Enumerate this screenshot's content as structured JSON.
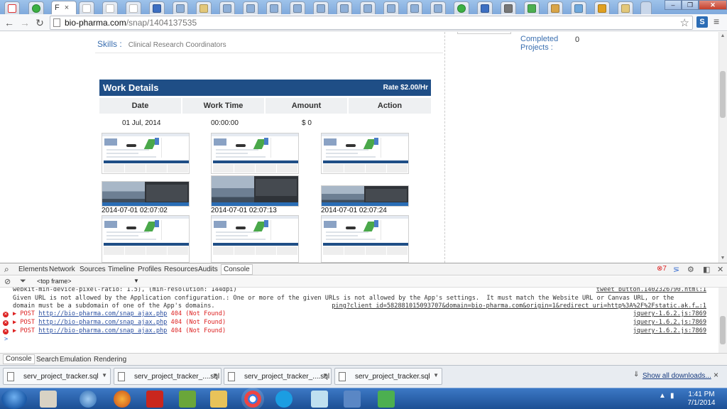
{
  "browser": {
    "active_tab_title": "F",
    "tab_close": "×",
    "url_host": "bio-pharma.com",
    "url_path": "/snap/1404137535",
    "extension_letter": "S"
  },
  "page": {
    "skills_label": "Skills :",
    "skills_value": "Clinical Research Coordinators",
    "completed_label_1": "Completed",
    "completed_label_2": "Projects :",
    "completed_value": "0",
    "work_details_title": "Work Details",
    "rate": "Rate $2.00/Hr",
    "columns": [
      "Date",
      "Work Time",
      "Amount",
      "Action"
    ],
    "row": {
      "date": "01 Jul, 2014",
      "work_time": "00:00:00",
      "amount": "$ 0"
    },
    "timestamps": [
      "2014-07-01 02:07:02",
      "2014-07-01 02:07:13",
      "2014-07-01 02:07:24"
    ]
  },
  "devtools": {
    "tabs": [
      "Elements",
      "Network",
      "Sources",
      "Timeline",
      "Profiles",
      "Resources",
      "Audits",
      "Console"
    ],
    "error_count": "7",
    "frame": "<top frame>",
    "lines": [
      {
        "text": "webkit-min-device-pixel-ratio: 1.5), (min-resolution: 144dpi)",
        "src": "tweet_button.1402326790.html:1"
      },
      {
        "text": "Given URL is not allowed by the Application configuration.: One or more of the given URLs is not allowed by the App's settings.  It must match the Website URL or Canvas URL, or the",
        "src": ""
      },
      {
        "text": "domain must be a subdomain of one of the App's domains.",
        "src": "ping?client_id=582881015093707&domain=bio-pharma.com&origin=1&redirect_uri=http%3A%2F%2Fstatic.ak.f…:1"
      }
    ],
    "errors": [
      {
        "method": "POST",
        "url": "http://bio-pharma.com/snap_ajax.php",
        "status": "404 (Not Found)",
        "src": "jquery-1.6.2.js:7869"
      },
      {
        "method": "POST",
        "url": "http://bio-pharma.com/snap_ajax.php",
        "status": "404 (Not Found)",
        "src": "jquery-1.6.2.js:7869"
      },
      {
        "method": "POST",
        "url": "http://bio-pharma.com/snap_ajax.php",
        "status": "404 (Not Found)",
        "src": "jquery-1.6.2.js:7869"
      }
    ],
    "prompt": ">",
    "drawer_tabs": [
      "Console",
      "Search",
      "Emulation",
      "Rendering"
    ]
  },
  "downloads": {
    "items": [
      "serv_project_tracker.sql",
      "serv_project_tracker_....sql",
      "serv_project_tracker_....sql",
      "serv_project_tracker.sql"
    ],
    "show_all": "Show all downloads...",
    "close": "×"
  },
  "taskbar": {
    "time": "1:41 PM",
    "date": "7/1/2014"
  },
  "colors": {
    "header_blue": "#1f4e86",
    "link_blue": "#3a6fb0",
    "error_red": "#d22"
  }
}
